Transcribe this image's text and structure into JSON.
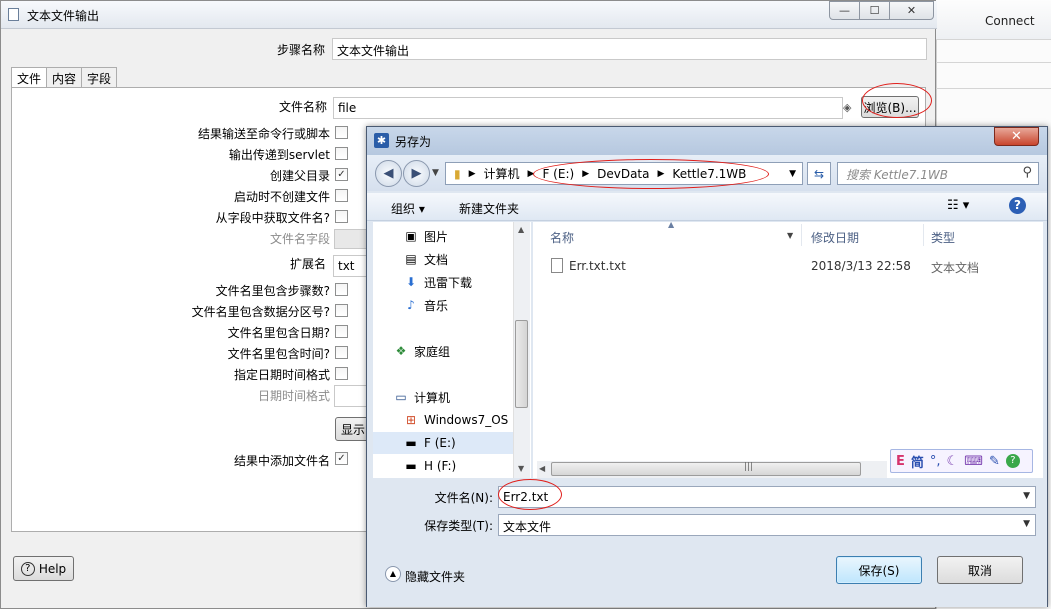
{
  "background_app": {
    "connect_label": "Connect"
  },
  "main_window": {
    "title": "文本文件输出",
    "step_name_label": "步骤名称",
    "step_name_value": "文本文件输出",
    "tabs": [
      "文件",
      "内容",
      "字段"
    ],
    "file_name_label": "文件名称",
    "file_name_value": "file",
    "browse_button": "浏览(B)...",
    "options": [
      {
        "label": "结果输送至命令行或脚本",
        "checked": false
      },
      {
        "label": "输出传递到servlet",
        "checked": false
      },
      {
        "label": "创建父目录",
        "checked": true
      },
      {
        "label": "启动时不创建文件",
        "checked": false
      },
      {
        "label": "从字段中获取文件名?",
        "checked": false
      }
    ],
    "filename_field_label": "文件名字段",
    "extension_label": "扩展名",
    "extension_value": "txt",
    "options2": [
      {
        "label": "文件名里包含步骤数?",
        "checked": false
      },
      {
        "label": "文件名里包含数据分区号?",
        "checked": false
      },
      {
        "label": "文件名里包含日期?",
        "checked": false
      },
      {
        "label": "文件名里包含时间?",
        "checked": false
      },
      {
        "label": "指定日期时间格式",
        "checked": false
      }
    ],
    "datetime_format_label": "日期时间格式",
    "show_button_partial": "显示",
    "add_filename_label": "结果中添加文件名",
    "add_filename_checked": true,
    "help_button": "Help"
  },
  "save_dialog": {
    "title": "另存为",
    "breadcrumb": [
      "计算机",
      "F (E:)",
      "DevData",
      "Kettle7.1WB"
    ],
    "search_placeholder": "搜索 Kettle7.1WB",
    "organize_label": "组织 ▾",
    "new_folder_label": "新建文件夹",
    "tree_items": [
      {
        "label": "图片",
        "icon": "pictures-icon"
      },
      {
        "label": "文档",
        "icon": "documents-icon"
      },
      {
        "label": "迅雷下载",
        "icon": "download-icon"
      },
      {
        "label": "音乐",
        "icon": "music-icon"
      },
      {
        "label": "家庭组",
        "icon": "homegroup-icon"
      },
      {
        "label": "计算机",
        "icon": "computer-icon"
      },
      {
        "label": "Windows7_OS (",
        "icon": "windows-drive-icon"
      },
      {
        "label": "F (E:)",
        "icon": "drive-icon"
      },
      {
        "label": "H (F:)",
        "icon": "drive-icon"
      }
    ],
    "columns": [
      "名称",
      "修改日期",
      "类型"
    ],
    "files": [
      {
        "name": "Err.txt.txt",
        "modified": "2018/3/13 22:58",
        "type": "文本文档"
      }
    ],
    "file_name_label": "文件名(N):",
    "file_name_value": "Err2.txt",
    "save_type_label": "保存类型(T):",
    "save_type_value": "文本文件",
    "hide_folders_label": "隐藏文件夹",
    "save_button": "保存(S)",
    "cancel_button": "取消"
  },
  "ime_toolbar": {
    "mode": "E",
    "lang": "简"
  }
}
